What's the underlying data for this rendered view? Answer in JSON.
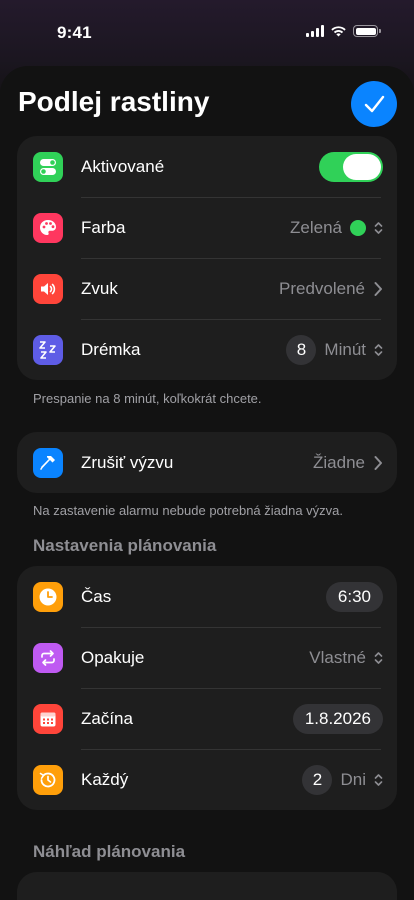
{
  "status_bar": {
    "time": "9:41"
  },
  "header": {
    "title": "Podlej rastliny"
  },
  "alarm_group": {
    "rows": [
      {
        "label": "Aktivované",
        "toggle_on": true,
        "icon": "toggle-icon",
        "icon_color": "#30d158"
      },
      {
        "label": "Farba",
        "value": "Zelená",
        "color_dot": "#30d158",
        "icon": "palette-icon",
        "icon_color": "#ff375f"
      },
      {
        "label": "Zvuk",
        "value": "Predvolené",
        "icon": "speaker-icon",
        "icon_color": "#ff453a"
      },
      {
        "label": "Drémka",
        "number": "8",
        "unit": "Minút",
        "icon": "snooze-icon",
        "icon_color": "#5e5ce6"
      }
    ],
    "footnote": "Prespanie na 8 minút, koľkokrát chcete."
  },
  "challenge_group": {
    "label": "Zrušiť výzvu",
    "value": "Žiadne",
    "icon": "hammer-icon",
    "icon_color": "#0a84ff",
    "footnote": "Na zastavenie alarmu nebude potrebná žiadna výzva."
  },
  "schedule_section": {
    "header": "Nastavenia plánovania",
    "rows": [
      {
        "label": "Čas",
        "value": "6:30",
        "icon": "clock-icon",
        "icon_color": "#ff9f0a"
      },
      {
        "label": "Opakuje",
        "value": "Vlastné",
        "icon": "repeat-icon",
        "icon_color": "#bf5af2"
      },
      {
        "label": "Začína",
        "value": "1.8.2026",
        "icon": "calendar-icon",
        "icon_color": "#ff453a"
      },
      {
        "label": "Každý",
        "number": "2",
        "unit": "Dni",
        "icon": "history-icon",
        "icon_color": "#ff9f0a"
      }
    ]
  },
  "preview_section": {
    "header": "Náhľad plánovania"
  },
  "colors": {
    "accent": "#0a84ff",
    "toggle_on": "#30d158",
    "card_bg": "#1e1e1e"
  }
}
